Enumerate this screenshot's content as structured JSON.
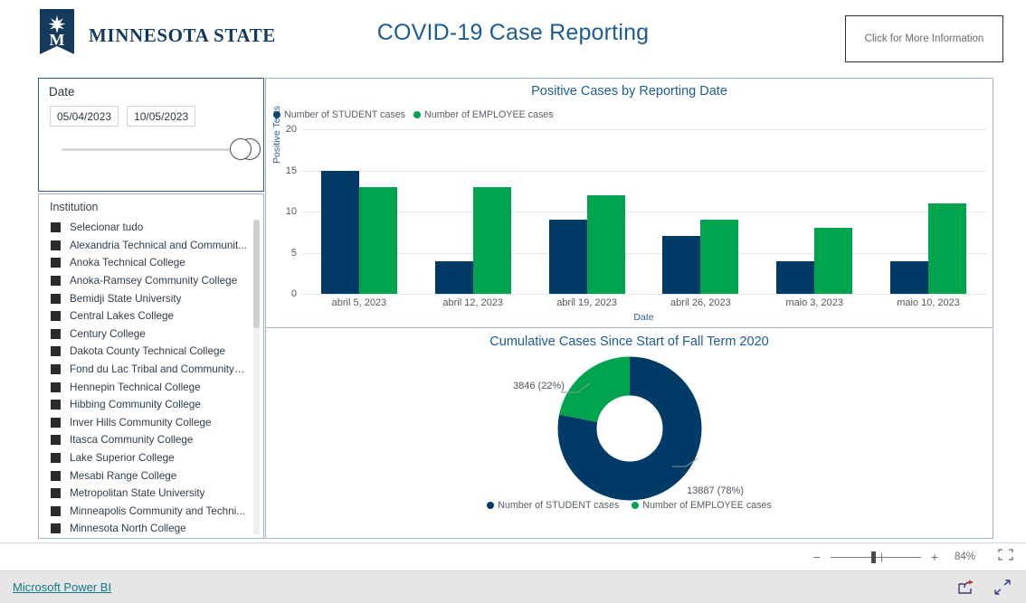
{
  "header": {
    "logo_text": "MINNESOTA STATE",
    "logo_icon": "minnesota-state-banner-logo",
    "title": "COVID-19 Case Reporting",
    "info_button_label": "Click for More Information"
  },
  "date_slicer": {
    "label": "Date",
    "start_value": "05/04/2023",
    "end_value": "10/05/2023",
    "handle_left_icon": "slider-handle-left",
    "handle_right_icon": "slider-handle-right"
  },
  "institution_slicer": {
    "title": "Institution",
    "items": [
      "Selecionar tudo",
      "Alexandria Technical and Communit...",
      "Anoka Technical College",
      "Anoka-Ramsey Community College",
      "Bemidji State University",
      "Central Lakes College",
      "Century College",
      "Dakota County Technical College",
      "Fond du Lac Tribal and Community C...",
      "Hennepin Technical College",
      "Hibbing Community College",
      "Inver Hills Community College",
      "Itasca Community College",
      "Lake Superior College",
      "Mesabi Range College",
      "Metropolitan State University",
      "Minneapolis Community and Techni...",
      "Minnesota North College"
    ]
  },
  "colors": {
    "student": "#003A66",
    "employee": "#00A44E",
    "title_blue": "#1C5C96",
    "link_teal": "#117a8b"
  },
  "chart_data": [
    {
      "type": "bar",
      "title": "Positive Cases by Reporting Date",
      "xlabel": "Date",
      "ylabel": "Positive Tests",
      "categories": [
        "abril 5, 2023",
        "abril 12, 2023",
        "abril 19, 2023",
        "abril 26, 2023",
        "maio 3, 2023",
        "maio 10, 2023"
      ],
      "series": [
        {
          "name": "Number of STUDENT cases",
          "color": "#003A66",
          "values": [
            15,
            4,
            9,
            7,
            4,
            4
          ]
        },
        {
          "name": "Number of EMPLOYEE cases",
          "color": "#00A44E",
          "values": [
            13,
            13,
            12,
            9,
            8,
            11
          ]
        }
      ],
      "ylim": [
        0,
        20
      ],
      "yticks": [
        0,
        5,
        10,
        15,
        20
      ],
      "grid": true,
      "legend_position": "top-left"
    },
    {
      "type": "pie",
      "title": "Cumulative Cases Since Start of Fall Term 2020",
      "donut": true,
      "labels": [
        "Number of STUDENT cases",
        "Number of EMPLOYEE cases"
      ],
      "values": [
        13887,
        3846
      ],
      "percentages": [
        "78%",
        "22%"
      ],
      "data_labels": [
        "13887 (78%)",
        "3846 (22%)"
      ],
      "colors": [
        "#003A66",
        "#00A44E"
      ],
      "legend_position": "bottom"
    }
  ],
  "statusbar": {
    "zoom_out_label": "−",
    "zoom_in_label": "+",
    "zoom_percent": "84%",
    "fit_icon": "fit-to-page-icon"
  },
  "footer": {
    "link_label": "Microsoft Power BI",
    "share_icon": "share-icon",
    "fullscreen_icon": "fullscreen-icon"
  }
}
